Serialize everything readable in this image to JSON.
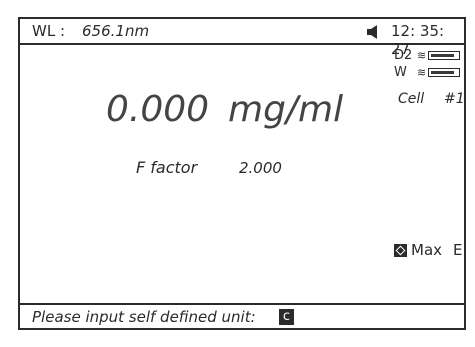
{
  "header": {
    "wl_label": "WL :",
    "wl_value": "656.1nm",
    "speaker_icon": "speaker-icon",
    "clock": "12: 35: 27"
  },
  "reading": {
    "value": "0.000",
    "unit": "mg/ml"
  },
  "lamps": [
    {
      "name": "D2",
      "ray_icon": "≋",
      "level": 0.9
    },
    {
      "name": "W",
      "ray_icon": "≋",
      "level": 0.9
    }
  ],
  "cell": {
    "label": "Cell",
    "number": "#1"
  },
  "factor": {
    "label": "F factor",
    "value": "2.000"
  },
  "max": {
    "icon": "diamond-icon",
    "label": "Max",
    "key": "E"
  },
  "prompt": {
    "text": "Please input self defined unit:",
    "input_value": "c"
  },
  "colors": {
    "foreground": "#2b2b2b",
    "background": "#ffffff"
  }
}
